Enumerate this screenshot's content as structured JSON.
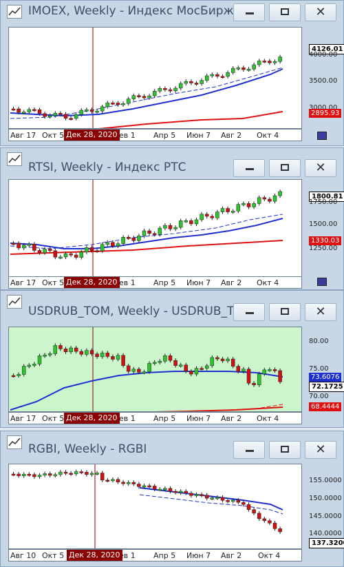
{
  "cursor_label": "Дек 28, 2020",
  "windows": [
    {
      "title": "IMOEX, Weekly - Индекс МосБиржи",
      "x_labels": [
        "Авг 17",
        "Окт 5",
        "ев 1",
        "Апр 5",
        "Июн 7",
        "Авг 2",
        "Окт 4"
      ],
      "y_labels": [
        "4000.00",
        "3500.00",
        "3000.00"
      ],
      "last_price": "4126.01",
      "ma_price": "2895.93",
      "bg": "#ffffff"
    },
    {
      "title": "RTSI, Weekly - Индекс РТС",
      "x_labels": [
        "Авг 17",
        "Окт 5",
        "ев 1",
        "Апр 5",
        "Июн 7",
        "Авг 2",
        "Окт 4"
      ],
      "y_labels": [
        "1750.00",
        "1500.00",
        "1250.00"
      ],
      "last_price": "1800.81",
      "ma_price": "1330.03",
      "bg": "#ffffff"
    },
    {
      "title": "USDRUB_TOM, Weekly - USDRUB_T...",
      "x_labels": [
        "Авг 17",
        "Окт 5",
        "ев 1",
        "Апр 5",
        "Июн 7",
        "Авг 2",
        "Окт 4"
      ],
      "y_labels": [
        "80.00",
        "75.00",
        "70.00"
      ],
      "last_price": "72.1725",
      "ma_price": "73.6076",
      "ma2_price": "68.4444",
      "bg": "#ccf5cc"
    },
    {
      "title": "RGBI, Weekly - RGBI",
      "x_labels": [
        "Авг 10",
        "Окт 5",
        "ев 1",
        "Апр 5",
        "Июн 7",
        "Авг 2",
        "Окт 4"
      ],
      "y_labels": [
        "155.0000",
        "150.0000",
        "145.0000",
        "140.0000"
      ],
      "last_price": "137.3200",
      "bg": "#ffffff"
    }
  ]
}
